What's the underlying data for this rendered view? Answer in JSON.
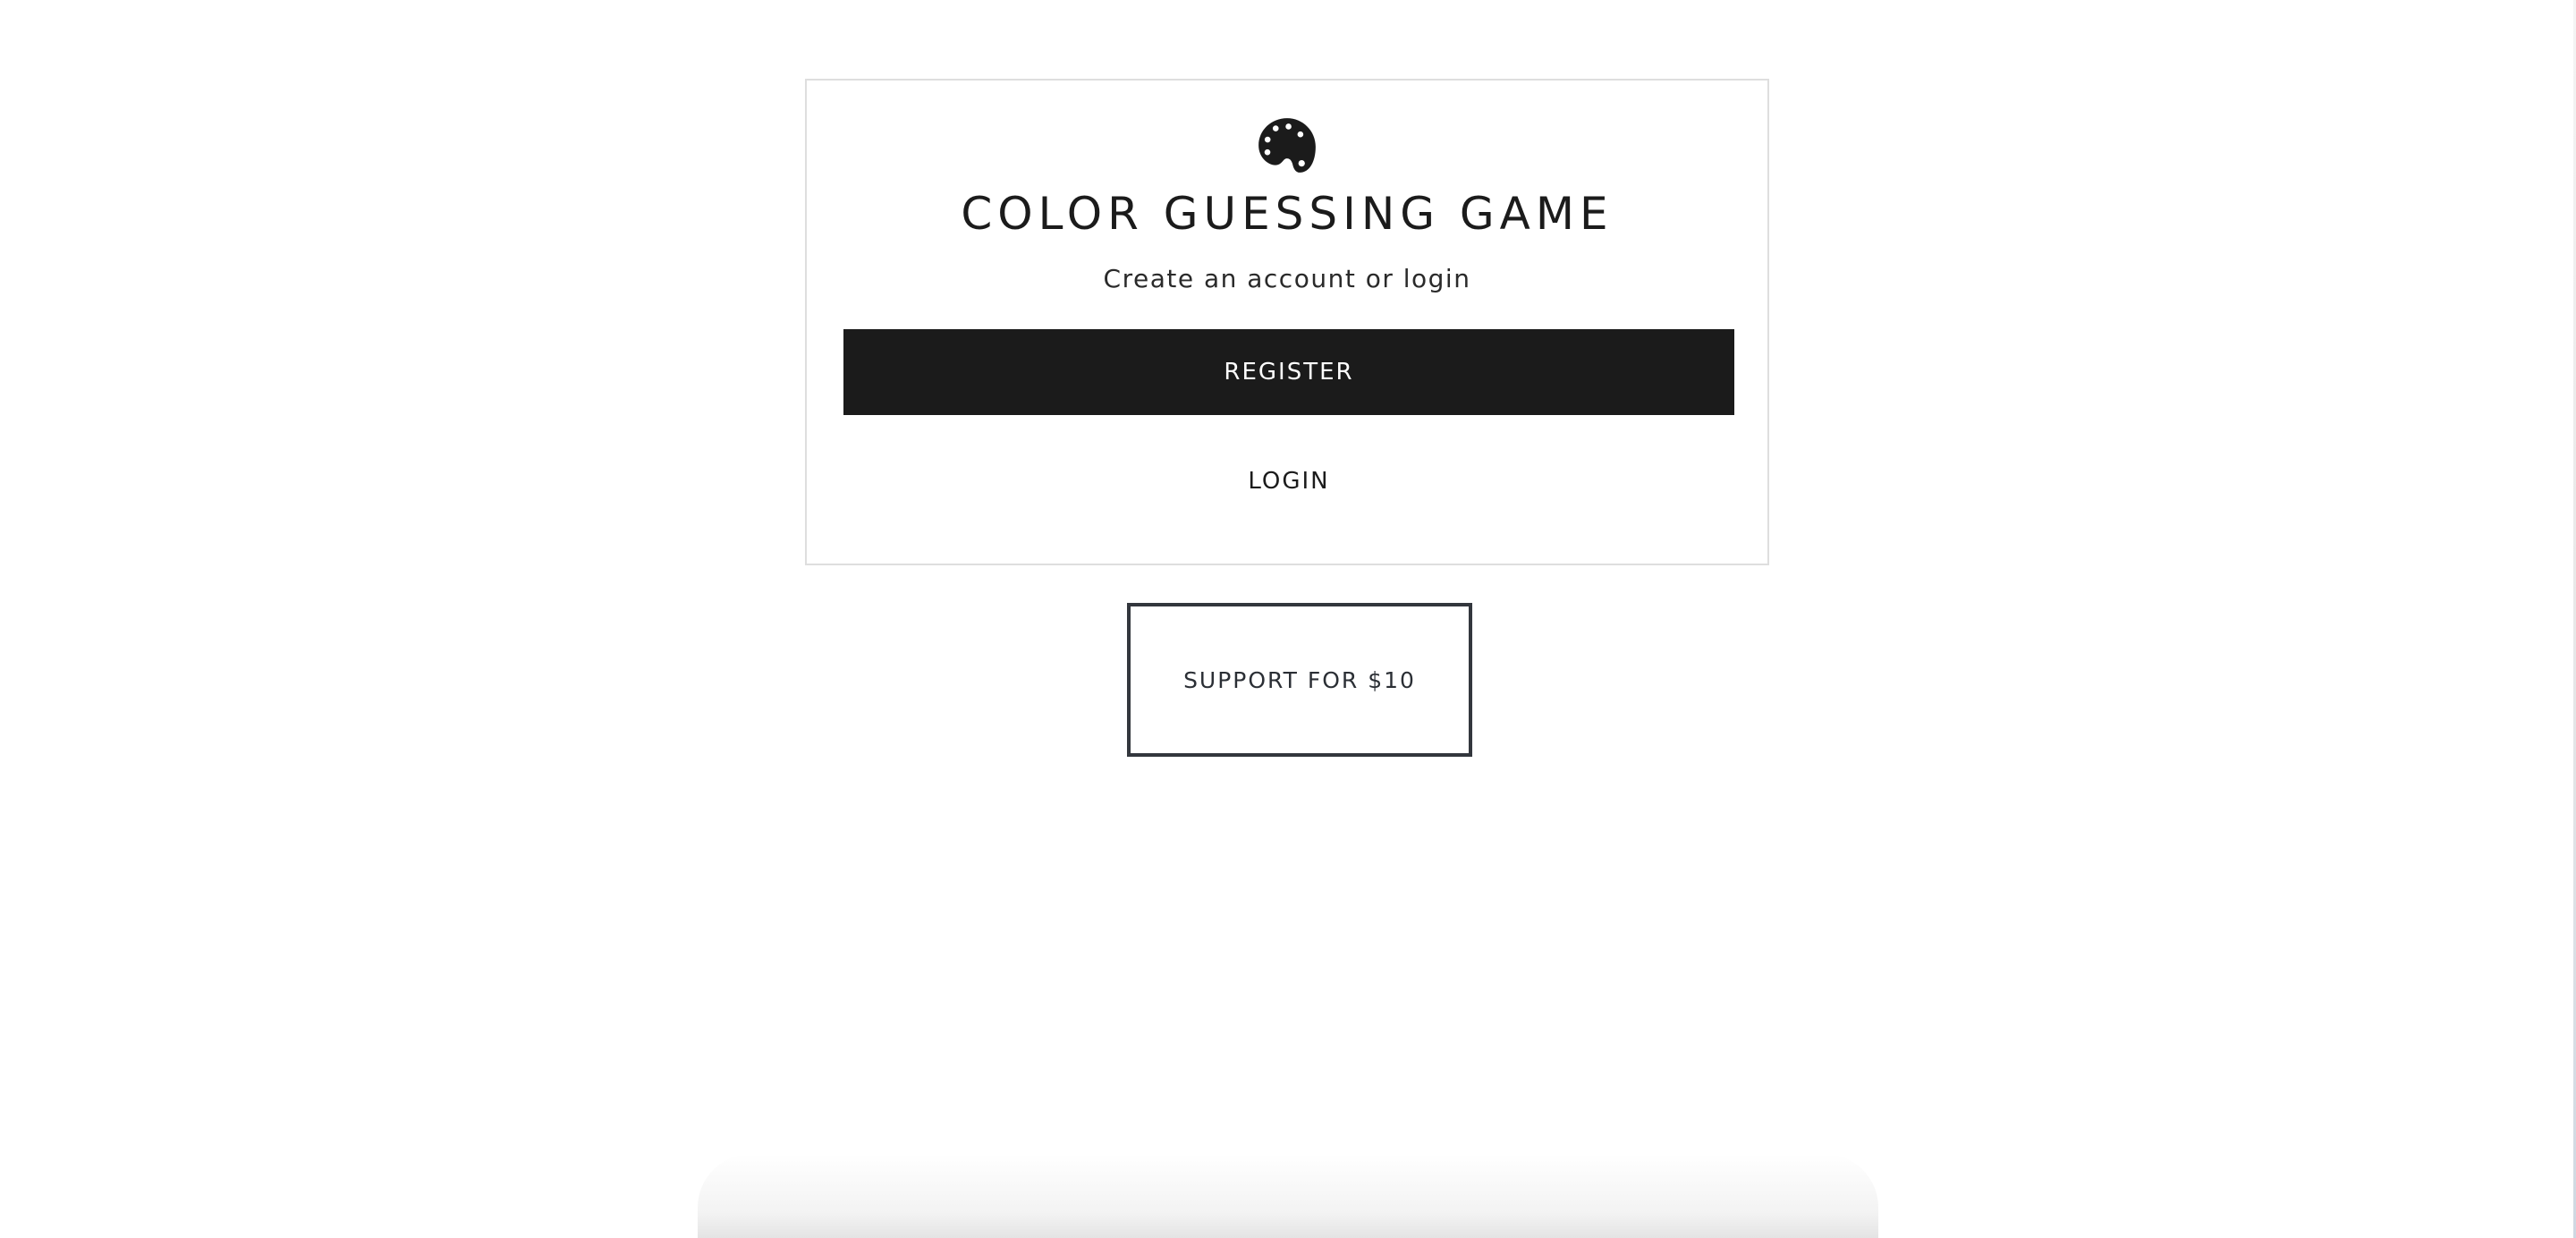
{
  "card": {
    "icon": "palette-icon",
    "title": "COLOR GUESSING GAME",
    "subtitle": "Create an account or login",
    "register_label": "REGISTER",
    "login_label": "LOGIN"
  },
  "support": {
    "label": "SUPPORT FOR $10"
  },
  "colors": {
    "primary": "#1b1b1b",
    "card_border": "#dedede",
    "support_border": "#33373d",
    "background": "#ffffff"
  }
}
